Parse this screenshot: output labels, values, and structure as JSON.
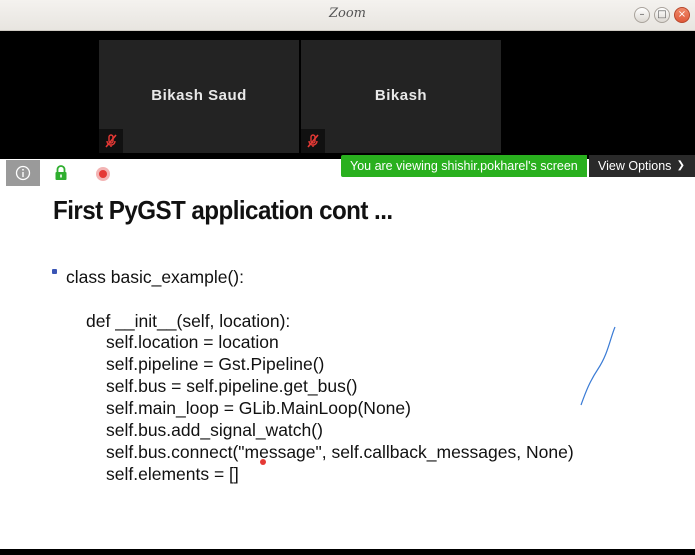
{
  "window": {
    "title": "Zoom"
  },
  "participants": [
    {
      "name": "Bikash Saud",
      "muted": true
    },
    {
      "name": "Bikash",
      "muted": true
    }
  ],
  "share": {
    "banner": "You are viewing shishir.pokharel's screen",
    "view_options": "View Options",
    "accent_color": "#29b01e"
  },
  "slide": {
    "title": "First PyGST application cont ...",
    "lines": [
      "class basic_example():",
      "def __init__(self, location):",
      "self.location = location",
      "self.pipeline = Gst.Pipeline()",
      "self.bus = self.pipeline.get_bus()",
      "self.main_loop = GLib.MainLoop(None)",
      "self.bus.add_signal_watch()",
      "self.bus.connect(\"message\", self.callback_messages, None)",
      "self.elements = []"
    ]
  }
}
